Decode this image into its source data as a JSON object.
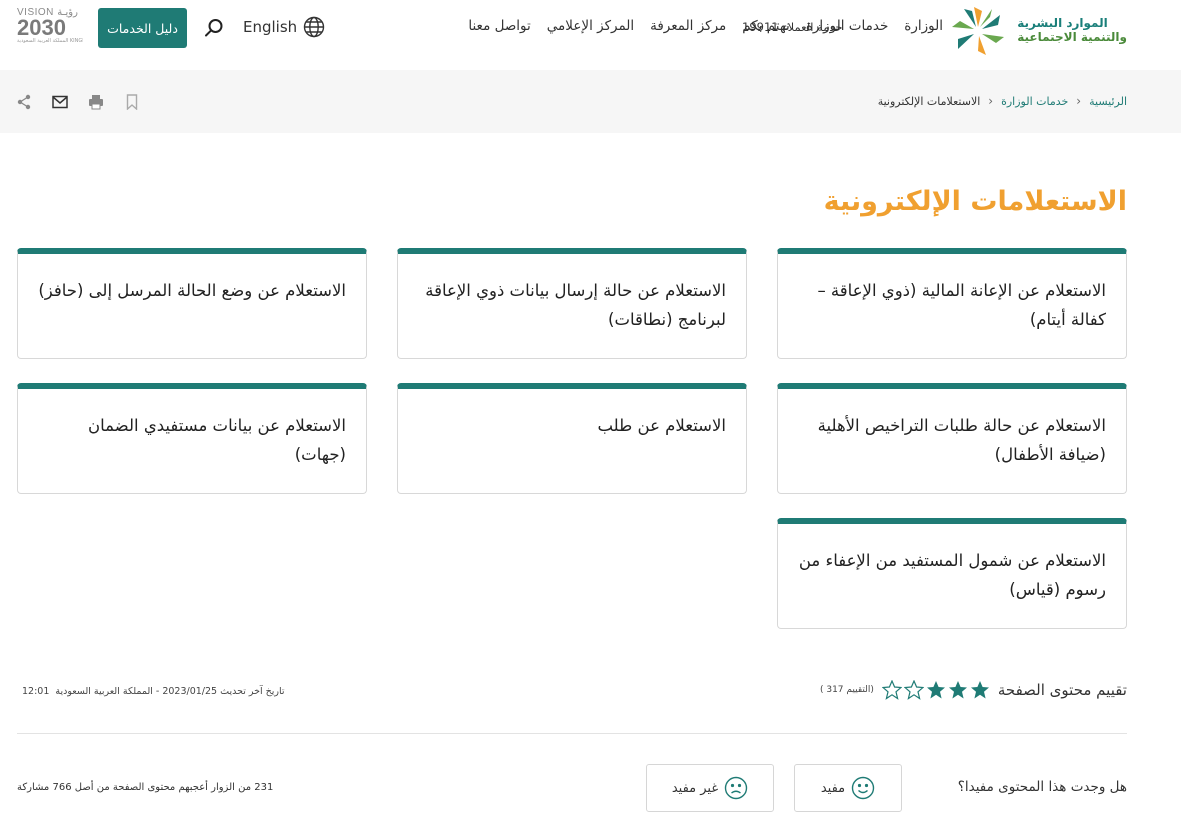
{
  "header": {
    "logo_line1": "الموارد البشرية",
    "logo_line2": "والتنمية الاجتماعية",
    "nav": [
      {
        "label": "الوزارة"
      },
      {
        "label": "خدمات الوزارة"
      },
      {
        "label": "نهتم بكم"
      },
      {
        "label": "مركز المعرفة"
      },
      {
        "label": "المركز الإعلامي"
      },
      {
        "label": "تواصل معنا"
      }
    ],
    "hotline": "خدمة العملاء 19911",
    "language": "English",
    "guide_button": "دليل الخدمات",
    "vision_top": "VISION رؤيـة",
    "vision_year": "2030",
    "vision_sub": "المملكة العربية السعودية KINGDOM OF SAUDI ARABIA"
  },
  "breadcrumb": {
    "home": "الرئيسية",
    "services": "خدمات الوزارة",
    "current": "الاستعلامات الإلكترونية"
  },
  "page_title": "الاستعلامات الإلكترونية",
  "cards": [
    {
      "text": "الاستعلام عن الإعانة المالية (ذوي الإعاقة – كفالة أيتام)"
    },
    {
      "text": "الاستعلام عن حالة إرسال بيانات ذوي الإعاقة لبرنامج (نطاقات)"
    },
    {
      "text": "الاستعلام عن وضع الحالة المرسل إلى (حافز)"
    },
    {
      "text": "الاستعلام عن حالة طلبات التراخيص الأهلية (ضيافة الأطفال)"
    },
    {
      "text": "الاستعلام عن طلب"
    },
    {
      "text": "الاستعلام عن بيانات مستفيدي الضمان (جهات)"
    },
    {
      "text": "الاستعلام عن شمول المستفيد من الإعفاء من رسوم (قياس)"
    }
  ],
  "rating": {
    "label": "تقييم محتوى الصفحة",
    "value": 3,
    "max": 5,
    "count": "(التقييم 317 )"
  },
  "meta": {
    "updated": "تاريخ آخر تحديث 2023/01/25 - المملكة العربية السعودية",
    "time": "12:01"
  },
  "feedback": {
    "question": "هل وجدت هذا المحتوى مفيدا؟",
    "yes": "مفيد",
    "no": "غير مفيد",
    "stat": "231 من الزوار أعجبهم محتوى الصفحة من أصل 766 مشاركة"
  },
  "colors": {
    "primary": "#1f7b75",
    "title": "#f0a030"
  }
}
